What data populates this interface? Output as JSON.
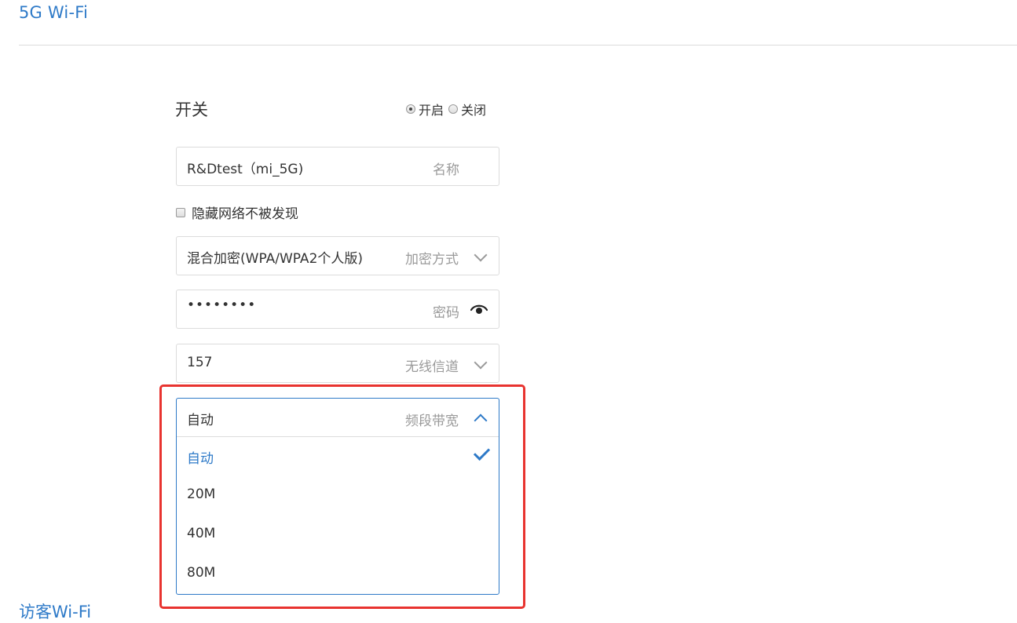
{
  "header": {
    "title": "5G Wi-Fi"
  },
  "switch": {
    "label": "开关",
    "options": [
      "开启",
      "关闭"
    ],
    "selected": "开启"
  },
  "name_field": {
    "value": "R&Dtest（mi_5G)",
    "hint": "名称"
  },
  "hidden_network": {
    "label": "隐藏网络不被发现",
    "checked": false
  },
  "encryption_field": {
    "value": "混合加密(WPA/WPA2个人版)",
    "hint": "加密方式",
    "icon": "chevron-down-icon"
  },
  "password_field": {
    "value": "••••••••",
    "hint": "密码",
    "icon": "eye-icon"
  },
  "channel_field": {
    "value": "157",
    "hint": "无线信道",
    "icon": "chevron-down-icon"
  },
  "bandwidth_dropdown": {
    "value": "自动",
    "hint": "频段带宽",
    "icon": "chevron-up-icon",
    "options": [
      {
        "label": "自动",
        "selected": true
      },
      {
        "label": "20M",
        "selected": false
      },
      {
        "label": "40M",
        "selected": false
      },
      {
        "label": "80M",
        "selected": false
      }
    ]
  },
  "next_section": {
    "title": "访客Wi-Fi"
  },
  "colors": {
    "accent": "#2e7ac8",
    "highlight": "#e8332f",
    "border": "#dcdcdc",
    "hint": "#9a9a9a"
  }
}
